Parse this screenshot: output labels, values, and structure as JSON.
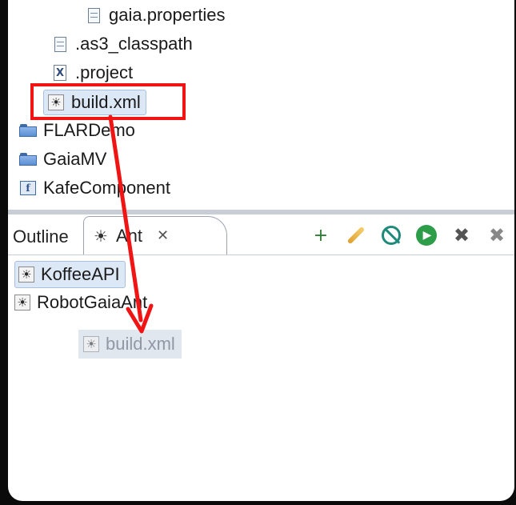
{
  "project_tree": {
    "items": [
      {
        "label": "gaia.properties",
        "icon": "properties-file-icon"
      },
      {
        "label": ".as3_classpath",
        "icon": "text-file-icon"
      },
      {
        "label": ".project",
        "icon": "xml-file-icon"
      },
      {
        "label": "build.xml",
        "icon": "ant-build-file-icon"
      },
      {
        "label": "FLARDemo",
        "icon": "folder-icon"
      },
      {
        "label": "GaiaMV",
        "icon": "folder-icon"
      },
      {
        "label": "KafeComponent",
        "icon": "flex-project-icon"
      }
    ],
    "xml_glyph": "X",
    "flex_glyph": "f"
  },
  "view": {
    "tabs": [
      {
        "label": "Outline",
        "active": false
      },
      {
        "label": "Ant",
        "active": true
      }
    ],
    "close_glyph": "✕"
  },
  "toolbar": {
    "buttons": [
      {
        "icon": "add-buildfile-icon",
        "glyph": "+"
      },
      {
        "icon": "search-buildfile-icon"
      },
      {
        "icon": "hide-internal-targets-icon"
      },
      {
        "icon": "run-target-icon",
        "glyph": "▶"
      },
      {
        "icon": "remove-icon",
        "glyph": "✖"
      },
      {
        "icon": "remove-all-icon",
        "glyph": "✖"
      }
    ]
  },
  "ant_view": {
    "items": [
      {
        "label": "KoffeeAPI"
      },
      {
        "label": "RobotGaiaAnt"
      }
    ],
    "drag_ghost_label": "build.xml"
  },
  "colors": {
    "highlight": "#f01414",
    "arrow": "#f01414",
    "selection": "#dde8f6"
  }
}
